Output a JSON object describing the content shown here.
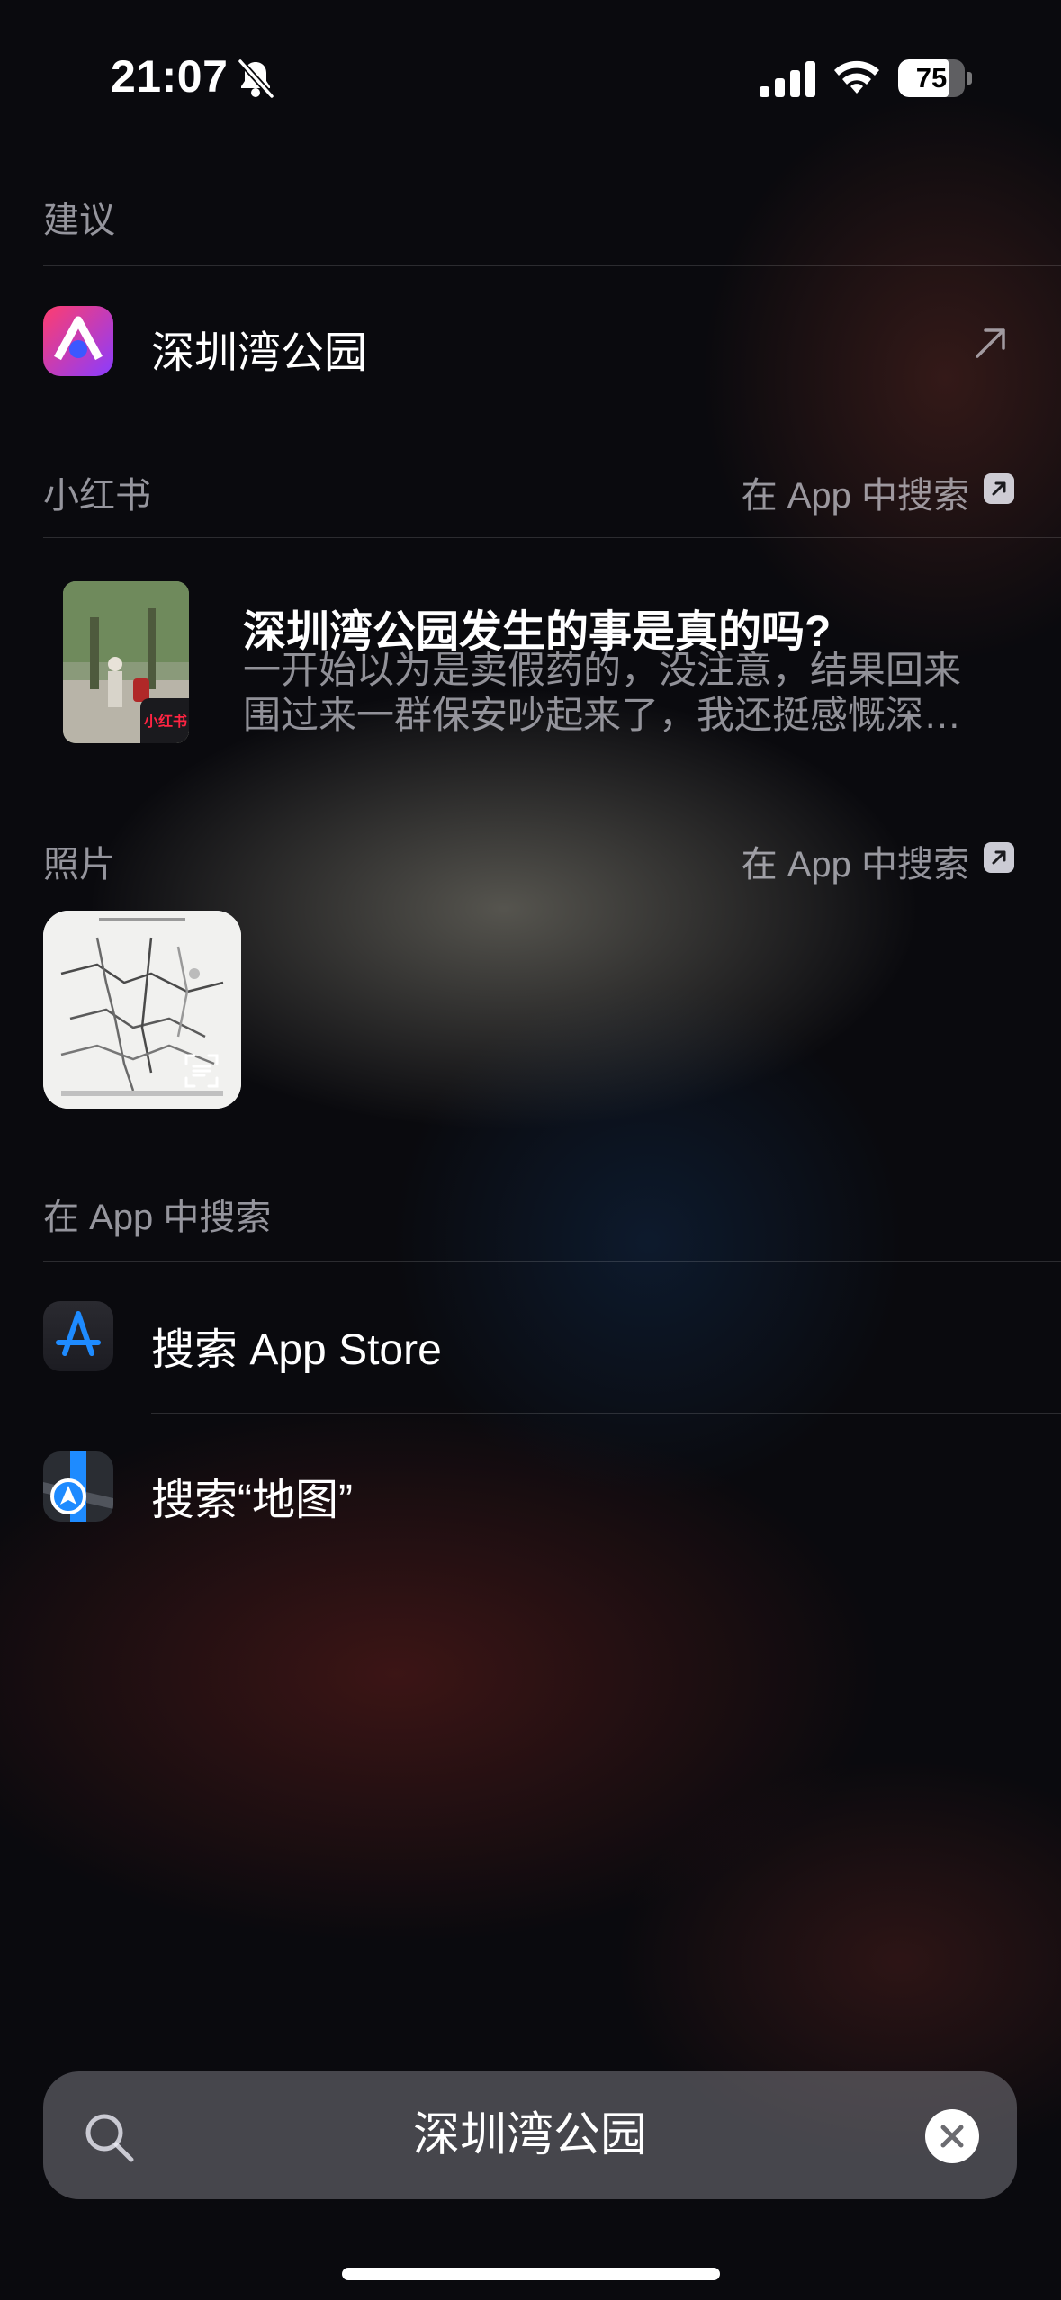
{
  "status_bar": {
    "time": "21:07",
    "battery": "75",
    "battery_level": 0.75
  },
  "suggestions": {
    "header": "建议",
    "item_label": "深圳湾公园"
  },
  "xiaohongshu": {
    "header": "小红书",
    "search_in_app": "在 App 中搜索",
    "result": {
      "badge": "小红书",
      "title": "深圳湾公园发生的事是真的吗?",
      "line1": "一开始以为是卖假药的，没注意，结果回来",
      "line2": "围过来一群保安吵起来了，我还挺感慨深…"
    }
  },
  "photos": {
    "header": "照片",
    "search_in_app": "在 App 中搜索"
  },
  "search_in_apps": {
    "header": "在 App 中搜索",
    "app_store_label": "搜索 App Store",
    "maps_label": "搜索“地图”"
  },
  "search_bar": {
    "value": "深圳湾公园"
  },
  "colors": {
    "secondary_text": "#EBEBF5",
    "app_store_blue": "#1E8BFF",
    "xiaohongshu_red": "#FF2442"
  },
  "icons": [
    "bell-slash-icon",
    "signal-icon",
    "wifi-icon",
    "battery-icon",
    "arrow-up-right-icon",
    "open-in-app-icon",
    "app-store-icon",
    "maps-icon",
    "magnifier-icon",
    "clear-icon",
    "scan-text-icon"
  ]
}
